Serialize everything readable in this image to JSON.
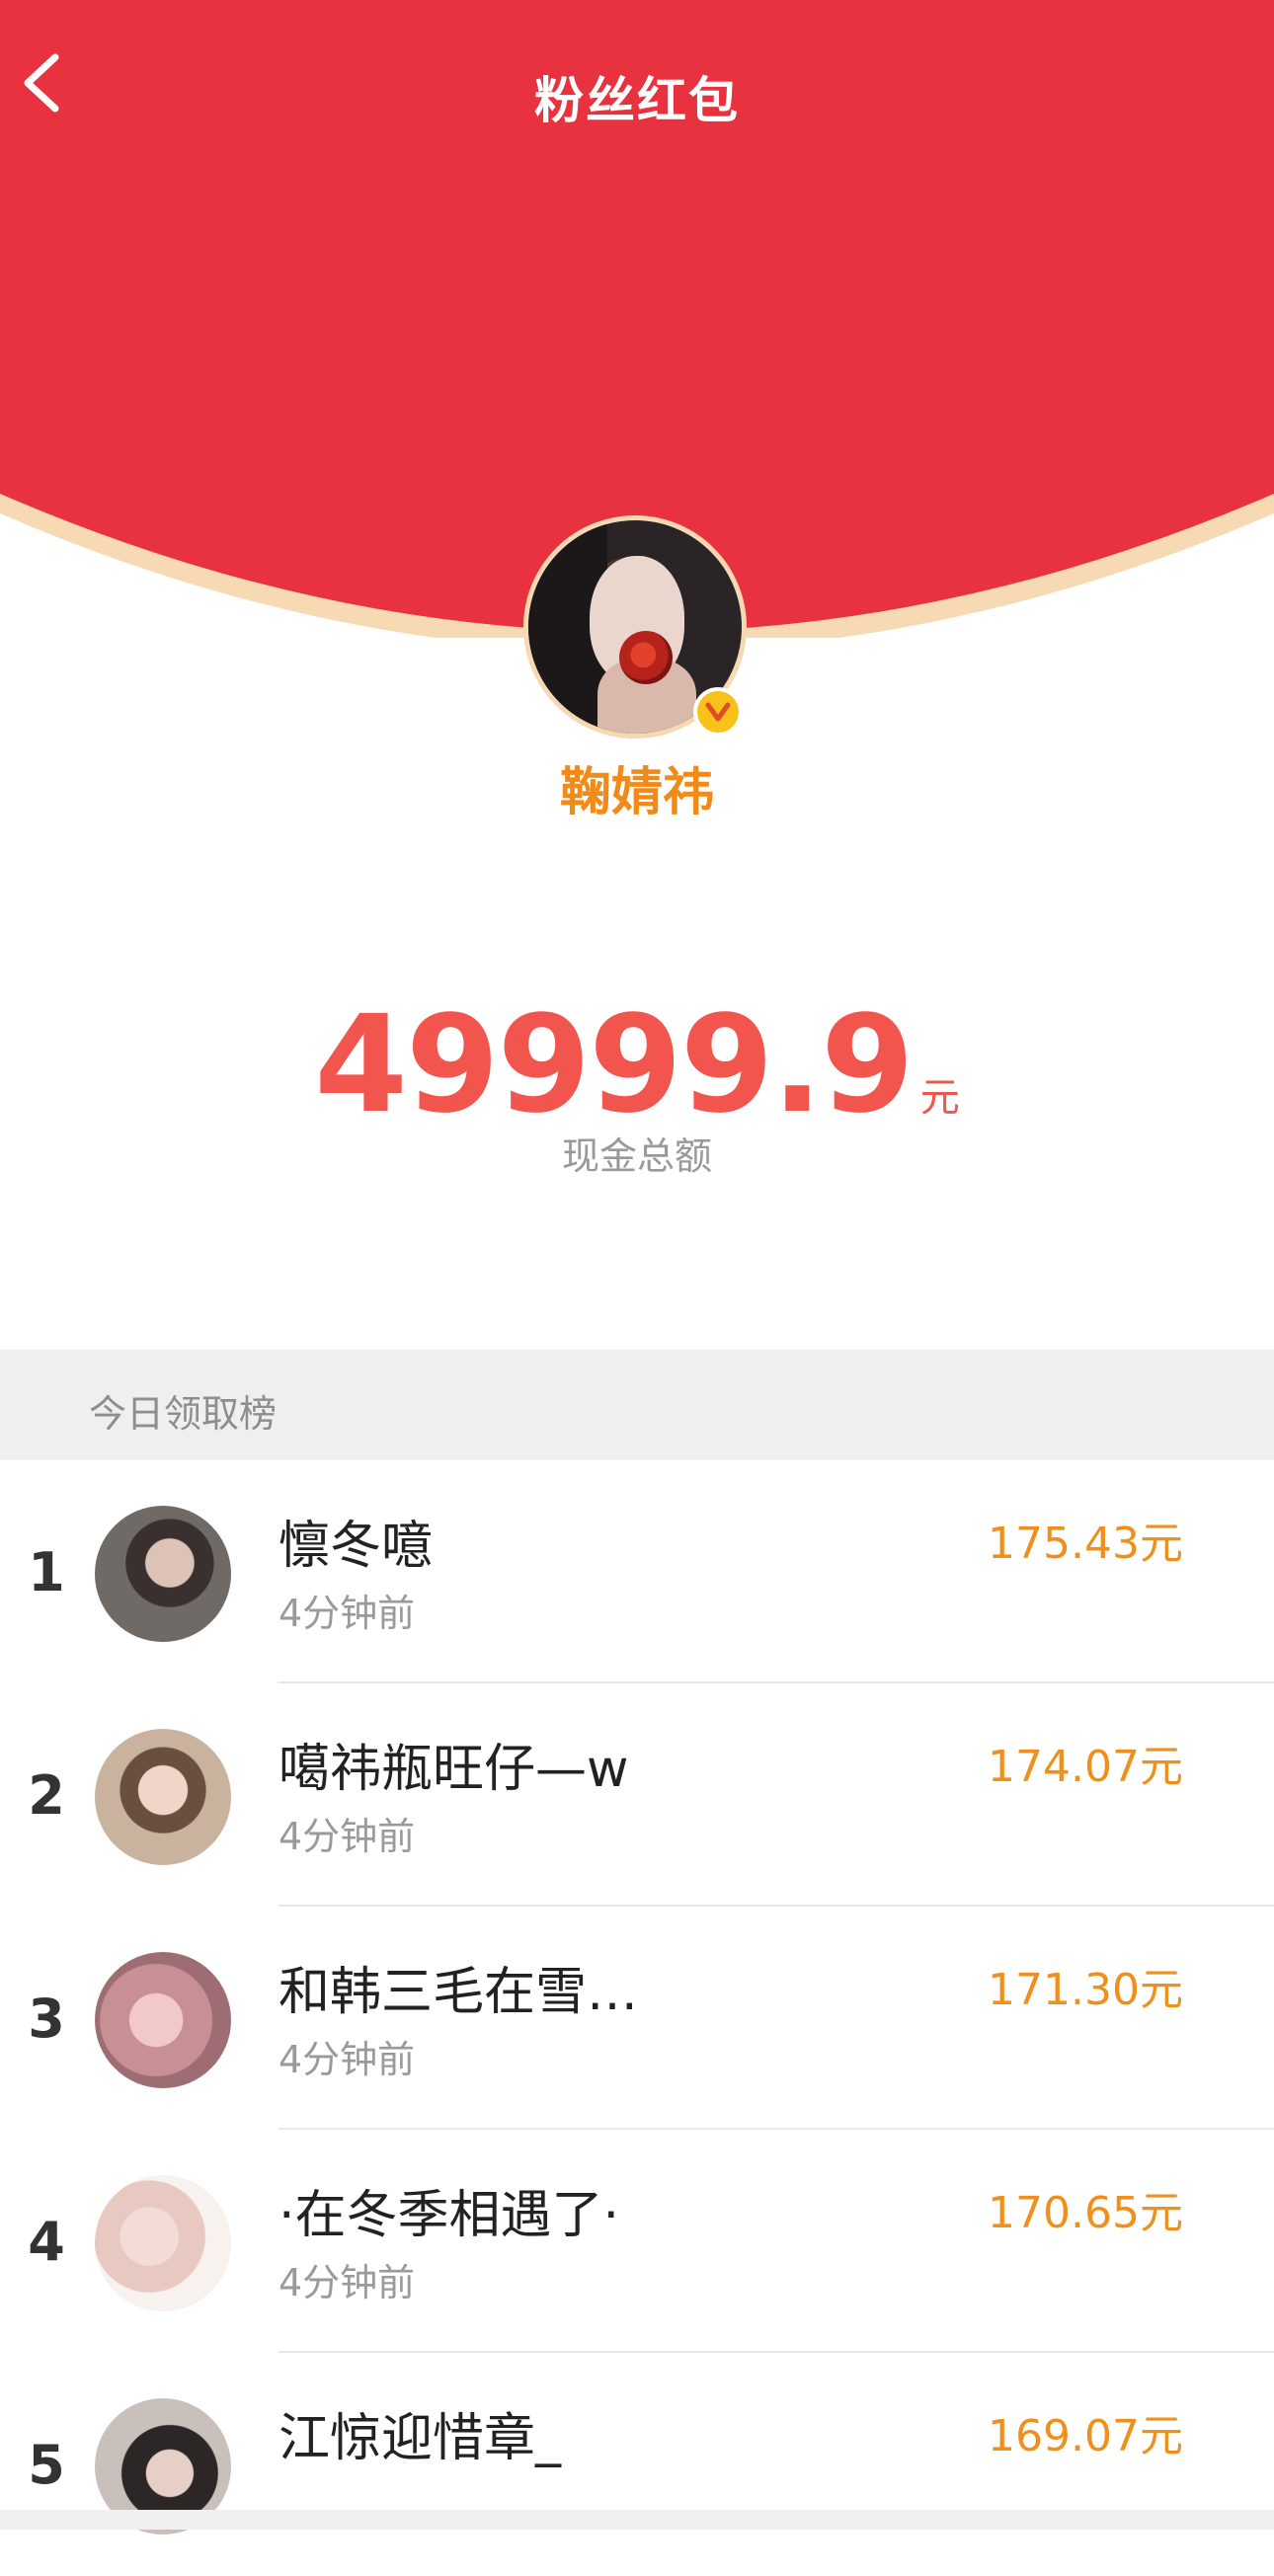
{
  "header": {
    "title": "粉丝红包",
    "back_icon": "chevron-left-icon"
  },
  "host": {
    "name": "鞠婧祎",
    "verified_icon": "verified-v-icon"
  },
  "amount": {
    "value": "49999.9",
    "unit": "元",
    "label": "现金总额"
  },
  "ranking": {
    "title": "今日领取榜",
    "rows": [
      {
        "rank": "1",
        "name": "懔冬噫",
        "time": "4分钟前",
        "amount": "175.43元"
      },
      {
        "rank": "2",
        "name": "噶祎瓶旺仔—w",
        "time": "4分钟前",
        "amount": "174.07元"
      },
      {
        "rank": "3",
        "name": "和韩三毛在雪…",
        "time": "4分钟前",
        "amount": "171.30元"
      },
      {
        "rank": "4",
        "name": "·在冬季相遇了·",
        "time": "4分钟前",
        "amount": "170.65元"
      },
      {
        "rank": "5",
        "name": "江惊迎惜章_",
        "time": "",
        "amount": "169.07元"
      }
    ]
  },
  "colors": {
    "header_red": "#e8323f",
    "header_rim": "#f7d9b4",
    "amount_red": "#f2554d",
    "accent_orange": "#f0901c"
  }
}
